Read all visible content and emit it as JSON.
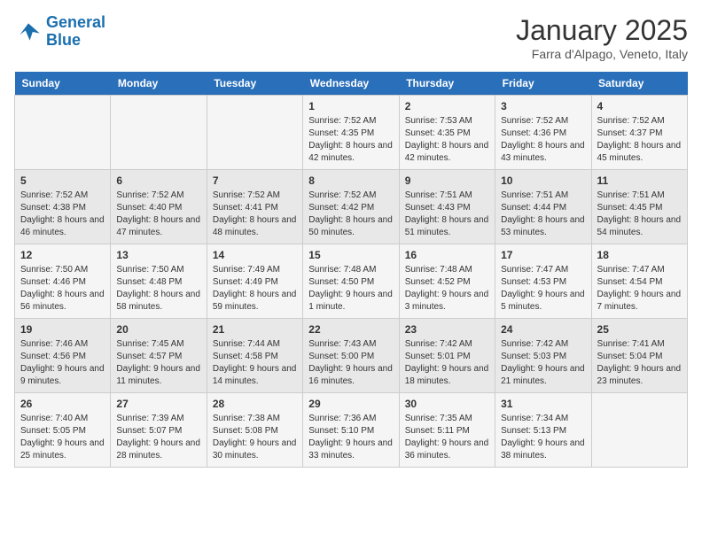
{
  "logo": {
    "line1": "General",
    "line2": "Blue"
  },
  "title": "January 2025",
  "location": "Farra d'Alpago, Veneto, Italy",
  "days_of_week": [
    "Sunday",
    "Monday",
    "Tuesday",
    "Wednesday",
    "Thursday",
    "Friday",
    "Saturday"
  ],
  "weeks": [
    [
      {
        "day": "",
        "info": ""
      },
      {
        "day": "",
        "info": ""
      },
      {
        "day": "",
        "info": ""
      },
      {
        "day": "1",
        "info": "Sunrise: 7:52 AM\nSunset: 4:35 PM\nDaylight: 8 hours and 42 minutes."
      },
      {
        "day": "2",
        "info": "Sunrise: 7:53 AM\nSunset: 4:35 PM\nDaylight: 8 hours and 42 minutes."
      },
      {
        "day": "3",
        "info": "Sunrise: 7:52 AM\nSunset: 4:36 PM\nDaylight: 8 hours and 43 minutes."
      },
      {
        "day": "4",
        "info": "Sunrise: 7:52 AM\nSunset: 4:37 PM\nDaylight: 8 hours and 45 minutes."
      }
    ],
    [
      {
        "day": "5",
        "info": "Sunrise: 7:52 AM\nSunset: 4:38 PM\nDaylight: 8 hours and 46 minutes."
      },
      {
        "day": "6",
        "info": "Sunrise: 7:52 AM\nSunset: 4:40 PM\nDaylight: 8 hours and 47 minutes."
      },
      {
        "day": "7",
        "info": "Sunrise: 7:52 AM\nSunset: 4:41 PM\nDaylight: 8 hours and 48 minutes."
      },
      {
        "day": "8",
        "info": "Sunrise: 7:52 AM\nSunset: 4:42 PM\nDaylight: 8 hours and 50 minutes."
      },
      {
        "day": "9",
        "info": "Sunrise: 7:51 AM\nSunset: 4:43 PM\nDaylight: 8 hours and 51 minutes."
      },
      {
        "day": "10",
        "info": "Sunrise: 7:51 AM\nSunset: 4:44 PM\nDaylight: 8 hours and 53 minutes."
      },
      {
        "day": "11",
        "info": "Sunrise: 7:51 AM\nSunset: 4:45 PM\nDaylight: 8 hours and 54 minutes."
      }
    ],
    [
      {
        "day": "12",
        "info": "Sunrise: 7:50 AM\nSunset: 4:46 PM\nDaylight: 8 hours and 56 minutes."
      },
      {
        "day": "13",
        "info": "Sunrise: 7:50 AM\nSunset: 4:48 PM\nDaylight: 8 hours and 58 minutes."
      },
      {
        "day": "14",
        "info": "Sunrise: 7:49 AM\nSunset: 4:49 PM\nDaylight: 8 hours and 59 minutes."
      },
      {
        "day": "15",
        "info": "Sunrise: 7:48 AM\nSunset: 4:50 PM\nDaylight: 9 hours and 1 minute."
      },
      {
        "day": "16",
        "info": "Sunrise: 7:48 AM\nSunset: 4:52 PM\nDaylight: 9 hours and 3 minutes."
      },
      {
        "day": "17",
        "info": "Sunrise: 7:47 AM\nSunset: 4:53 PM\nDaylight: 9 hours and 5 minutes."
      },
      {
        "day": "18",
        "info": "Sunrise: 7:47 AM\nSunset: 4:54 PM\nDaylight: 9 hours and 7 minutes."
      }
    ],
    [
      {
        "day": "19",
        "info": "Sunrise: 7:46 AM\nSunset: 4:56 PM\nDaylight: 9 hours and 9 minutes."
      },
      {
        "day": "20",
        "info": "Sunrise: 7:45 AM\nSunset: 4:57 PM\nDaylight: 9 hours and 11 minutes."
      },
      {
        "day": "21",
        "info": "Sunrise: 7:44 AM\nSunset: 4:58 PM\nDaylight: 9 hours and 14 minutes."
      },
      {
        "day": "22",
        "info": "Sunrise: 7:43 AM\nSunset: 5:00 PM\nDaylight: 9 hours and 16 minutes."
      },
      {
        "day": "23",
        "info": "Sunrise: 7:42 AM\nSunset: 5:01 PM\nDaylight: 9 hours and 18 minutes."
      },
      {
        "day": "24",
        "info": "Sunrise: 7:42 AM\nSunset: 5:03 PM\nDaylight: 9 hours and 21 minutes."
      },
      {
        "day": "25",
        "info": "Sunrise: 7:41 AM\nSunset: 5:04 PM\nDaylight: 9 hours and 23 minutes."
      }
    ],
    [
      {
        "day": "26",
        "info": "Sunrise: 7:40 AM\nSunset: 5:05 PM\nDaylight: 9 hours and 25 minutes."
      },
      {
        "day": "27",
        "info": "Sunrise: 7:39 AM\nSunset: 5:07 PM\nDaylight: 9 hours and 28 minutes."
      },
      {
        "day": "28",
        "info": "Sunrise: 7:38 AM\nSunset: 5:08 PM\nDaylight: 9 hours and 30 minutes."
      },
      {
        "day": "29",
        "info": "Sunrise: 7:36 AM\nSunset: 5:10 PM\nDaylight: 9 hours and 33 minutes."
      },
      {
        "day": "30",
        "info": "Sunrise: 7:35 AM\nSunset: 5:11 PM\nDaylight: 9 hours and 36 minutes."
      },
      {
        "day": "31",
        "info": "Sunrise: 7:34 AM\nSunset: 5:13 PM\nDaylight: 9 hours and 38 minutes."
      },
      {
        "day": "",
        "info": ""
      }
    ]
  ]
}
